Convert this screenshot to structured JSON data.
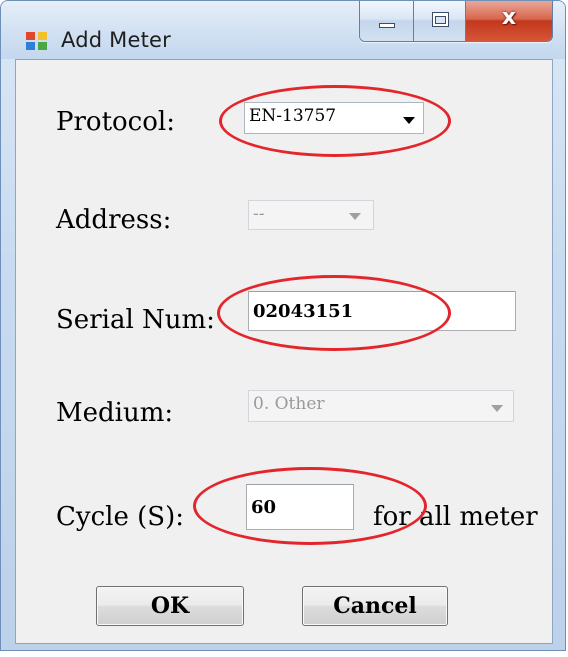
{
  "window": {
    "title": "Add Meter",
    "icon": "app-window-icon",
    "controls": {
      "minimize": "minimize-icon",
      "maximize": "maximize-icon",
      "close_glyph": "x"
    }
  },
  "form": {
    "protocol": {
      "label": "Protocol:",
      "selected": "EN-13757",
      "enabled": true
    },
    "address": {
      "label": "Address:",
      "selected": "--",
      "enabled": false
    },
    "serial": {
      "label": "Serial Num:",
      "value": "02043151"
    },
    "medium": {
      "label": "Medium:",
      "selected": "0. Other",
      "enabled": false
    },
    "cycle": {
      "label": "Cycle (S):",
      "value": "60",
      "suffix": "for all meter"
    }
  },
  "buttons": {
    "ok": "OK",
    "cancel": "Cancel"
  },
  "annotations": {
    "color": "#e3262b"
  },
  "colors": {
    "client_bg": "#f0f0f0",
    "frame_border": "#6d8fb8",
    "close_button": "#c3381c"
  }
}
